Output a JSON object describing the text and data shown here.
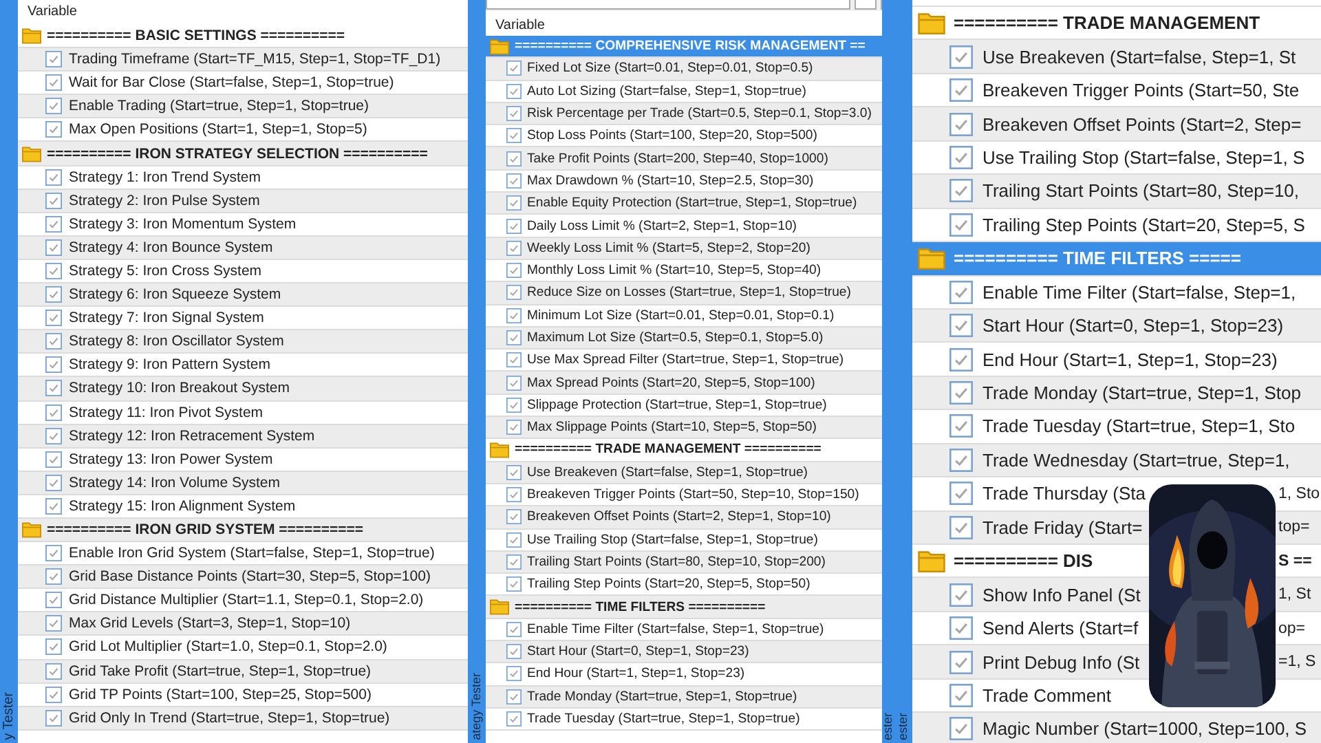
{
  "panels": [
    {
      "column_header": "Variable",
      "left_label": "y Tester",
      "rows": [
        {
          "kind": "group",
          "text": "========== BASIC SETTINGS ==========",
          "selected": false
        },
        {
          "kind": "param",
          "text": "Trading Timeframe (Start=TF_M15, Step=1, Stop=TF_D1)",
          "checked": true,
          "selected": false
        },
        {
          "kind": "param",
          "text": "Wait for Bar Close (Start=false, Step=1, Stop=true)",
          "checked": true,
          "selected": false
        },
        {
          "kind": "param",
          "text": "Enable Trading (Start=true, Step=1, Stop=true)",
          "checked": true,
          "selected": false
        },
        {
          "kind": "param",
          "text": "Max Open Positions (Start=1, Step=1, Stop=5)",
          "checked": true,
          "selected": false
        },
        {
          "kind": "group",
          "text": "========== IRON STRATEGY SELECTION ==========",
          "selected": false
        },
        {
          "kind": "param",
          "text": "Strategy 1: Iron Trend System",
          "checked": true,
          "selected": false
        },
        {
          "kind": "param",
          "text": "Strategy 2: Iron Pulse System",
          "checked": true,
          "selected": false
        },
        {
          "kind": "param",
          "text": "Strategy 3: Iron Momentum System",
          "checked": true,
          "selected": false
        },
        {
          "kind": "param",
          "text": "Strategy 4: Iron Bounce System",
          "checked": true,
          "selected": false
        },
        {
          "kind": "param",
          "text": "Strategy 5: Iron Cross System",
          "checked": true,
          "selected": false
        },
        {
          "kind": "param",
          "text": "Strategy 6: Iron Squeeze System",
          "checked": true,
          "selected": false
        },
        {
          "kind": "param",
          "text": "Strategy 7: Iron Signal System",
          "checked": true,
          "selected": false
        },
        {
          "kind": "param",
          "text": "Strategy 8: Iron Oscillator System",
          "checked": true,
          "selected": false
        },
        {
          "kind": "param",
          "text": "Strategy 9: Iron Pattern System",
          "checked": true,
          "selected": false
        },
        {
          "kind": "param",
          "text": "Strategy 10: Iron Breakout System",
          "checked": true,
          "selected": false
        },
        {
          "kind": "param",
          "text": "Strategy 11: Iron Pivot System",
          "checked": true,
          "selected": false
        },
        {
          "kind": "param",
          "text": "Strategy 12: Iron Retracement System",
          "checked": true,
          "selected": false
        },
        {
          "kind": "param",
          "text": "Strategy 13: Iron Power System",
          "checked": true,
          "selected": false
        },
        {
          "kind": "param",
          "text": "Strategy 14: Iron Volume System",
          "checked": true,
          "selected": false
        },
        {
          "kind": "param",
          "text": "Strategy 15: Iron Alignment System",
          "checked": true,
          "selected": false
        },
        {
          "kind": "group",
          "text": "========== IRON GRID SYSTEM ==========",
          "selected": false
        },
        {
          "kind": "param",
          "text": "Enable Iron Grid System (Start=false, Step=1, Stop=true)",
          "checked": true,
          "selected": false
        },
        {
          "kind": "param",
          "text": "Grid Base Distance Points (Start=30, Step=5, Stop=100)",
          "checked": true,
          "selected": false
        },
        {
          "kind": "param",
          "text": "Grid Distance Multiplier (Start=1.1, Step=0.1, Stop=2.0)",
          "checked": true,
          "selected": false
        },
        {
          "kind": "param",
          "text": "Max Grid Levels (Start=3, Step=1, Stop=10)",
          "checked": true,
          "selected": false
        },
        {
          "kind": "param",
          "text": "Grid Lot Multiplier (Start=1.0, Step=0.1, Stop=2.0)",
          "checked": true,
          "selected": false
        },
        {
          "kind": "param",
          "text": "Grid Take Profit (Start=true, Step=1, Stop=true)",
          "checked": true,
          "selected": false
        },
        {
          "kind": "param",
          "text": "Grid TP Points (Start=100, Step=25, Stop=500)",
          "checked": true,
          "selected": false
        },
        {
          "kind": "param",
          "text": "Grid Only In Trend (Start=true, Step=1, Stop=true)",
          "checked": true,
          "selected": false
        }
      ]
    },
    {
      "column_header": "Variable",
      "left_label": "ategy Tester",
      "right_label": "ester",
      "rows": [
        {
          "kind": "group",
          "text": "========== COMPREHENSIVE RISK MANAGEMENT ==",
          "selected": true
        },
        {
          "kind": "param",
          "text": "Fixed Lot Size (Start=0.01, Step=0.01, Stop=0.5)",
          "checked": true,
          "selected": false
        },
        {
          "kind": "param",
          "text": "Auto Lot Sizing (Start=false, Step=1, Stop=true)",
          "checked": true,
          "selected": false
        },
        {
          "kind": "param",
          "text": "Risk Percentage per Trade (Start=0.5, Step=0.1, Stop=3.0)",
          "checked": true,
          "selected": false
        },
        {
          "kind": "param",
          "text": "Stop Loss Points (Start=100, Step=20, Stop=500)",
          "checked": true,
          "selected": false
        },
        {
          "kind": "param",
          "text": "Take Profit Points (Start=200, Step=40, Stop=1000)",
          "checked": true,
          "selected": false
        },
        {
          "kind": "param",
          "text": "Max Drawdown % (Start=10, Step=2.5, Stop=30)",
          "checked": true,
          "selected": false
        },
        {
          "kind": "param",
          "text": "Enable Equity Protection (Start=true, Step=1, Stop=true)",
          "checked": true,
          "selected": false
        },
        {
          "kind": "param",
          "text": "Daily Loss Limit % (Start=2, Step=1, Stop=10)",
          "checked": true,
          "selected": false
        },
        {
          "kind": "param",
          "text": "Weekly Loss Limit % (Start=5, Step=2, Stop=20)",
          "checked": true,
          "selected": false
        },
        {
          "kind": "param",
          "text": "Monthly Loss Limit % (Start=10, Step=5, Stop=40)",
          "checked": true,
          "selected": false
        },
        {
          "kind": "param",
          "text": "Reduce Size on Losses (Start=true, Step=1, Stop=true)",
          "checked": true,
          "selected": false
        },
        {
          "kind": "param",
          "text": "Minimum Lot Size (Start=0.01, Step=0.01, Stop=0.1)",
          "checked": true,
          "selected": false
        },
        {
          "kind": "param",
          "text": "Maximum Lot Size (Start=0.5, Step=0.1, Stop=5.0)",
          "checked": true,
          "selected": false
        },
        {
          "kind": "param",
          "text": "Use Max Spread Filter (Start=true, Step=1, Stop=true)",
          "checked": true,
          "selected": false
        },
        {
          "kind": "param",
          "text": "Max Spread Points (Start=20, Step=5, Stop=100)",
          "checked": true,
          "selected": false
        },
        {
          "kind": "param",
          "text": "Slippage Protection (Start=true, Step=1, Stop=true)",
          "checked": true,
          "selected": false
        },
        {
          "kind": "param",
          "text": "Max Slippage Points (Start=10, Step=5, Stop=50)",
          "checked": true,
          "selected": false
        },
        {
          "kind": "group",
          "text": "========== TRADE MANAGEMENT ==========",
          "selected": false
        },
        {
          "kind": "param",
          "text": "Use Breakeven (Start=false, Step=1, Stop=true)",
          "checked": true,
          "selected": false
        },
        {
          "kind": "param",
          "text": "Breakeven Trigger Points (Start=50, Step=10, Stop=150)",
          "checked": true,
          "selected": false
        },
        {
          "kind": "param",
          "text": "Breakeven Offset Points (Start=2, Step=1, Stop=10)",
          "checked": true,
          "selected": false
        },
        {
          "kind": "param",
          "text": "Use Trailing Stop (Start=false, Step=1, Stop=true)",
          "checked": true,
          "selected": false
        },
        {
          "kind": "param",
          "text": "Trailing Start Points (Start=80, Step=10, Stop=200)",
          "checked": true,
          "selected": false
        },
        {
          "kind": "param",
          "text": "Trailing Step Points (Start=20, Step=5, Stop=50)",
          "checked": true,
          "selected": false
        },
        {
          "kind": "group",
          "text": "========== TIME FILTERS ==========",
          "selected": false
        },
        {
          "kind": "param",
          "text": "Enable Time Filter (Start=false, Step=1, Stop=true)",
          "checked": true,
          "selected": false
        },
        {
          "kind": "param",
          "text": "Start Hour (Start=0, Step=1, Stop=23)",
          "checked": true,
          "selected": false
        },
        {
          "kind": "param",
          "text": "End Hour (Start=1, Step=1, Stop=23)",
          "checked": true,
          "selected": false
        },
        {
          "kind": "param",
          "text": "Trade Monday (Start=true, Step=1, Stop=true)",
          "checked": true,
          "selected": false
        },
        {
          "kind": "param",
          "text": "Trade Tuesday (Start=true, Step=1, Stop=true)",
          "checked": true,
          "selected": false
        }
      ]
    },
    {
      "left_label": "ester",
      "rows": [
        {
          "kind": "group",
          "text": "========== TRADE MANAGEMENT",
          "selected": false
        },
        {
          "kind": "param",
          "text": "Use Breakeven (Start=false, Step=1, St",
          "checked": true,
          "selected": false
        },
        {
          "kind": "param",
          "text": "Breakeven Trigger Points (Start=50, Ste",
          "checked": true,
          "selected": false
        },
        {
          "kind": "param",
          "text": "Breakeven Offset Points (Start=2, Step=",
          "checked": true,
          "selected": false
        },
        {
          "kind": "param",
          "text": "Use Trailing Stop (Start=false, Step=1, S",
          "checked": true,
          "selected": false
        },
        {
          "kind": "param",
          "text": "Trailing Start Points (Start=80, Step=10,",
          "checked": true,
          "selected": false
        },
        {
          "kind": "param",
          "text": "Trailing Step Points (Start=20, Step=5, S",
          "checked": true,
          "selected": false
        },
        {
          "kind": "group",
          "text": "========== TIME FILTERS =====",
          "selected": true
        },
        {
          "kind": "param",
          "text": "Enable Time Filter (Start=false, Step=1,",
          "checked": true,
          "selected": false
        },
        {
          "kind": "param",
          "text": "Start Hour (Start=0, Step=1, Stop=23)",
          "checked": true,
          "selected": false
        },
        {
          "kind": "param",
          "text": "End Hour (Start=1, Step=1, Stop=23)",
          "checked": true,
          "selected": false
        },
        {
          "kind": "param",
          "text": "Trade Monday (Start=true, Step=1, Stop",
          "checked": true,
          "selected": false
        },
        {
          "kind": "param",
          "text": "Trade Tuesday (Start=true, Step=1, Sto",
          "checked": true,
          "selected": false
        },
        {
          "kind": "param",
          "text": "Trade Wednesday (Start=true, Step=1,",
          "checked": true,
          "selected": false
        },
        {
          "kind": "param",
          "text": "Trade Thursday (Sta",
          "tail": "1, Sto",
          "checked": true,
          "selected": false
        },
        {
          "kind": "param",
          "text": "Trade Friday (Start=",
          "tail": "top=",
          "checked": true,
          "selected": false
        },
        {
          "kind": "group",
          "text": "========== DIS",
          "tail": "S ==",
          "selected": false
        },
        {
          "kind": "param",
          "text": "Show Info Panel (St",
          "tail": "1, St",
          "checked": true,
          "selected": false
        },
        {
          "kind": "param",
          "text": "Send Alerts (Start=f",
          "tail": "op=",
          "checked": true,
          "selected": false
        },
        {
          "kind": "param",
          "text": "Print Debug Info (St",
          "tail": "=1, S",
          "checked": true,
          "selected": false
        },
        {
          "kind": "param",
          "text": "Trade Comment",
          "checked": true,
          "selected": false
        },
        {
          "kind": "param",
          "text": "Magic Number (Start=1000, Step=100, S",
          "checked": true,
          "selected": false
        }
      ]
    }
  ]
}
